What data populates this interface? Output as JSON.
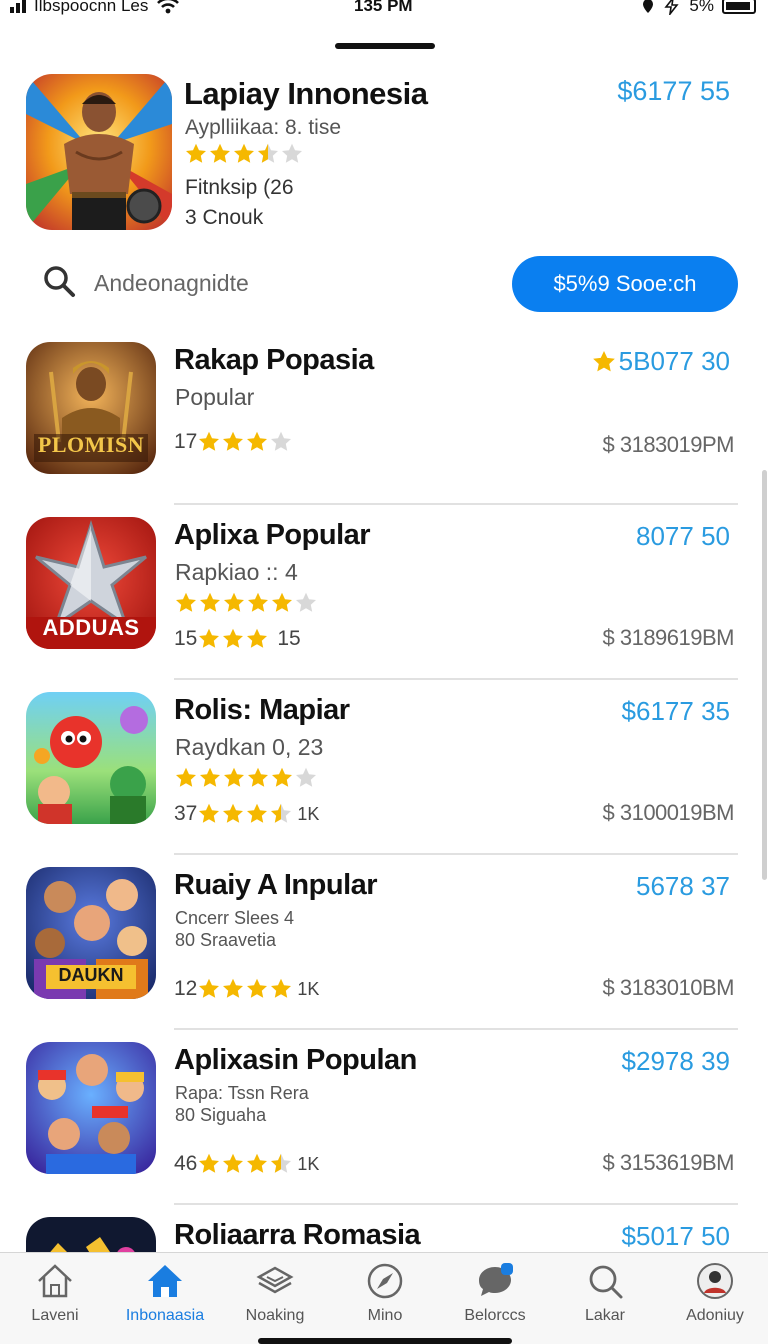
{
  "status_bar": {
    "carrier": "Ilbspoocnn Les",
    "time": "135 PM",
    "battery": "5%"
  },
  "featured": {
    "title": "Lapiay Innonesia",
    "subtitle": "Ayplliikaa: 8. tise",
    "rating": 3.5,
    "line1": "Fitnksip (26",
    "line2": "3 Cnouk",
    "price": "$6177 55"
  },
  "search": {
    "placeholder": "Andeonagnidte",
    "button_label": "$5%9 Sooe:ch"
  },
  "apps": [
    {
      "title": "Rakap Popasia",
      "subtitle": "Popular",
      "meta_prefix": "17",
      "meta_suffix": "",
      "stars": 3,
      "price": "5B077 30",
      "price_has_star": true,
      "date": "$ 3183019PM",
      "icon_text": "PLOMISN"
    },
    {
      "title": "Aplixa Popular",
      "subtitle": "Rapkiao :: 4",
      "meta_prefix": "15",
      "meta_suffix": "15",
      "stars": 3,
      "row_stars": 4.5,
      "price": "8077 50",
      "price_has_star": false,
      "date": "$ 3189619BM",
      "icon_text": "ADDUAS"
    },
    {
      "title": "Rolis: Mapiar",
      "subtitle": "Raydkan 0, 23",
      "meta_prefix": "37",
      "meta_suffix": "1K",
      "stars": 3.5,
      "row_stars": 4.5,
      "price": "$6177 35",
      "price_has_star": false,
      "date": "$ 3100019BM",
      "icon_text": ""
    },
    {
      "title": "Ruaiy A Inpular",
      "subtitle": "Cncerr Slees 4",
      "subtitle2": "80 Sraavetia",
      "meta_prefix": "12",
      "meta_suffix": "1K",
      "stars": 4,
      "price": "5678 37",
      "price_has_star": false,
      "date": "$ 3183010BM",
      "icon_text": "DAUKN"
    },
    {
      "title": "Aplixasin Populan",
      "subtitle": "Rapa: Tssn Rera",
      "subtitle2": "80 Siguaha",
      "meta_prefix": "46",
      "meta_suffix": "1K",
      "stars": 3.5,
      "price": "$2978 39",
      "price_has_star": false,
      "date": "$ 3153619BM",
      "icon_text": ""
    },
    {
      "title": "Roliaarra Romasia",
      "price": "$5017 50",
      "price_has_star": false
    }
  ],
  "tabs": [
    {
      "label": "Laveni",
      "icon": "home-outline-icon"
    },
    {
      "label": "Inbonaasia",
      "icon": "home-filled-icon",
      "active": true
    },
    {
      "label": "Noaking",
      "icon": "stack-icon"
    },
    {
      "label": "Mino",
      "icon": "compass-icon"
    },
    {
      "label": "Belorccs",
      "icon": "chat-bubble-icon"
    },
    {
      "label": "Lakar",
      "icon": "search-icon"
    },
    {
      "label": "Adoniuy",
      "icon": "avatar-icon"
    }
  ],
  "colors": {
    "accent": "#0a7ff0",
    "price": "#2a9be0",
    "star": "#f5b800"
  }
}
